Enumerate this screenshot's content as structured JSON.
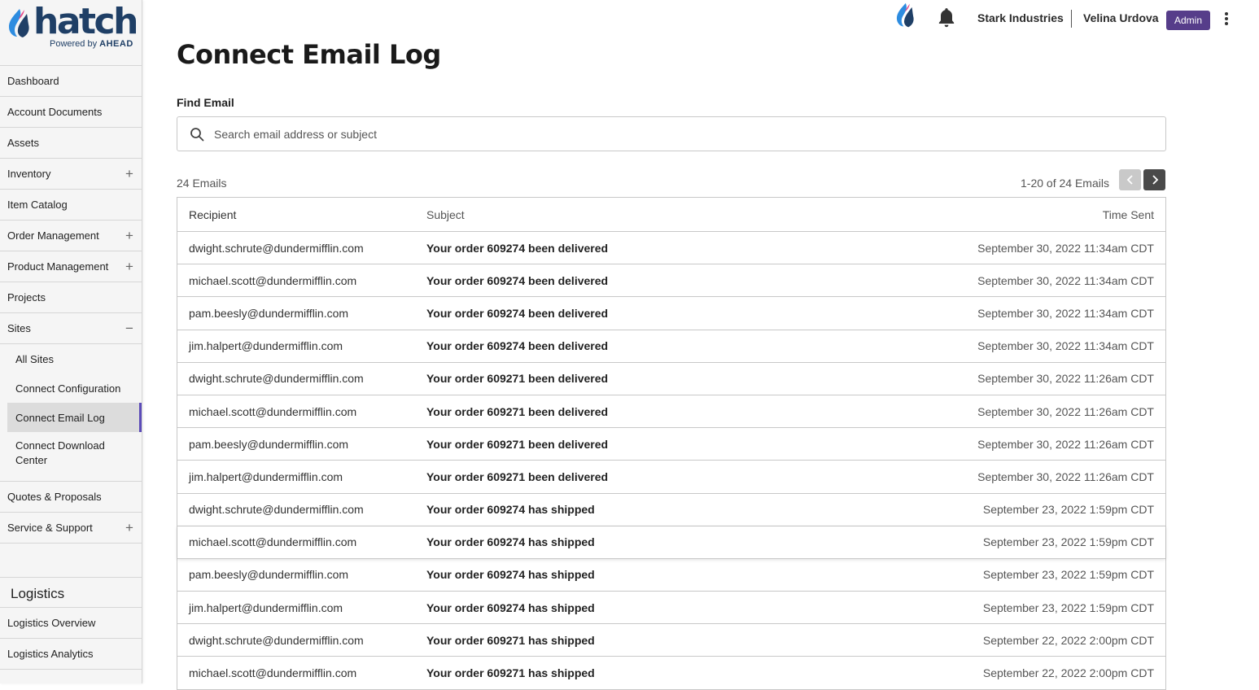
{
  "brand": {
    "name": "hatch",
    "powered_by": "Powered by",
    "powered_brand": "AHEAD"
  },
  "header": {
    "company": "Stark Industries",
    "user": "Velina Urdova",
    "role": "Admin"
  },
  "sidebar": {
    "items": [
      {
        "label": "Dashboard",
        "toggle": ""
      },
      {
        "label": "Account Documents",
        "toggle": ""
      },
      {
        "label": "Assets",
        "toggle": ""
      },
      {
        "label": "Inventory",
        "toggle": "+"
      },
      {
        "label": "Item Catalog",
        "toggle": ""
      },
      {
        "label": "Order Management",
        "toggle": "+"
      },
      {
        "label": "Product Management",
        "toggle": "+"
      },
      {
        "label": "Projects",
        "toggle": ""
      },
      {
        "label": "Sites",
        "toggle": "−"
      }
    ],
    "sites_sub": [
      "All Sites",
      "Connect Configuration",
      "Connect Email Log",
      "Connect Download Center"
    ],
    "items_after": [
      {
        "label": "Quotes & Proposals",
        "toggle": ""
      },
      {
        "label": "Service & Support",
        "toggle": "+"
      }
    ],
    "logistics_title": "Logistics",
    "logistics_items": [
      "Logistics Overview",
      "Logistics Analytics"
    ]
  },
  "main": {
    "title": "Connect Email Log",
    "find_label": "Find Email",
    "search_placeholder": "Search email address or subject",
    "count": "24 Emails",
    "pager": "1-20 of 24 Emails",
    "columns": [
      "Recipient",
      "Subject",
      "Time Sent"
    ],
    "rows": [
      [
        "dwight.schrute@dundermifflin.com",
        "Your order 609274 been delivered",
        "September 30, 2022 11:34am CDT"
      ],
      [
        "michael.scott@dundermifflin.com",
        "Your order 609274 been delivered",
        "September 30, 2022 11:34am CDT"
      ],
      [
        "pam.beesly@dundermifflin.com",
        "Your order 609274 been delivered",
        "September 30, 2022 11:34am CDT"
      ],
      [
        "jim.halpert@dundermifflin.com",
        "Your order 609274 been delivered",
        "September 30, 2022 11:34am CDT"
      ],
      [
        "dwight.schrute@dundermifflin.com",
        "Your order 609271 been delivered",
        "September 30, 2022 11:26am CDT"
      ],
      [
        "michael.scott@dundermifflin.com",
        "Your order 609271 been delivered",
        "September 30, 2022 11:26am CDT"
      ],
      [
        "pam.beesly@dundermifflin.com",
        "Your order 609271 been delivered",
        "September 30, 2022 11:26am CDT"
      ],
      [
        "jim.halpert@dundermifflin.com",
        "Your order 609271 been delivered",
        "September 30, 2022 11:26am CDT"
      ],
      [
        "dwight.schrute@dundermifflin.com",
        "Your order 609274 has shipped",
        "September 23, 2022 1:59pm CDT"
      ],
      [
        "michael.scott@dundermifflin.com",
        "Your order 609274 has shipped",
        "September 23, 2022 1:59pm CDT"
      ],
      [
        "pam.beesly@dundermifflin.com",
        "Your order 609274 has shipped",
        "September 23, 2022 1:59pm CDT"
      ],
      [
        "jim.halpert@dundermifflin.com",
        "Your order 609274 has shipped",
        "September 23, 2022 1:59pm CDT"
      ],
      [
        "dwight.schrute@dundermifflin.com",
        "Your order 609271 has shipped",
        "September 22, 2022 2:00pm CDT"
      ],
      [
        "michael.scott@dundermifflin.com",
        "Your order 609271 has shipped",
        "September 22, 2022 2:00pm CDT"
      ]
    ]
  },
  "colors": {
    "brand_navy": "#1f3f66",
    "brand_blue": "#2d8ce0",
    "brand_pink": "#e84a8a",
    "admin_badge": "#563d8a",
    "active_indicator": "#5b4bb8"
  },
  "icons": {
    "search": "search-icon",
    "bell": "bell-icon",
    "kebab": "kebab-menu-icon",
    "prev": "chevron-left-icon",
    "next": "chevron-right-icon"
  }
}
